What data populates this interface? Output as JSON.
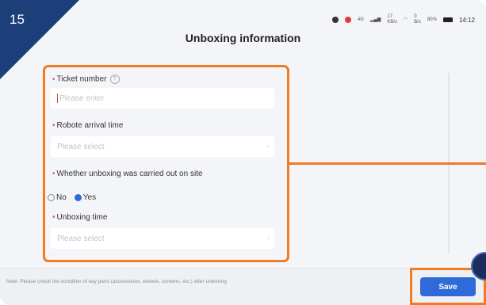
{
  "step_badge": "15",
  "status_bar": {
    "network_label": "4G",
    "speed_value": "17",
    "speed_unit": "KB/s",
    "wifi_speed_value": "0",
    "wifi_speed_unit": "B/s",
    "battery": "80%",
    "time": "14:12"
  },
  "page_title": "Unboxing information",
  "form": {
    "ticket_number_label": "Ticket number",
    "ticket_number_placeholder": "Please enter",
    "arrival_time_label": "Robote arrival time",
    "arrival_time_placeholder": "Please select",
    "unboxing_onsite_label": "Whether unboxing was carried out on site",
    "option_no": "No",
    "option_yes": "Yes",
    "selected_option": "Yes",
    "unboxing_time_label": "Unboxing time",
    "unboxing_time_placeholder": "Please select"
  },
  "footer": {
    "note": "Note: Please check the condition of key parts (accessories, wheels, screens, etc.) after unboxing",
    "save_label": "Save"
  },
  "colors": {
    "accent": "#2f6bd8",
    "highlight": "#f27a22",
    "badge": "#1c3f7a",
    "required": "#f05a5a"
  }
}
